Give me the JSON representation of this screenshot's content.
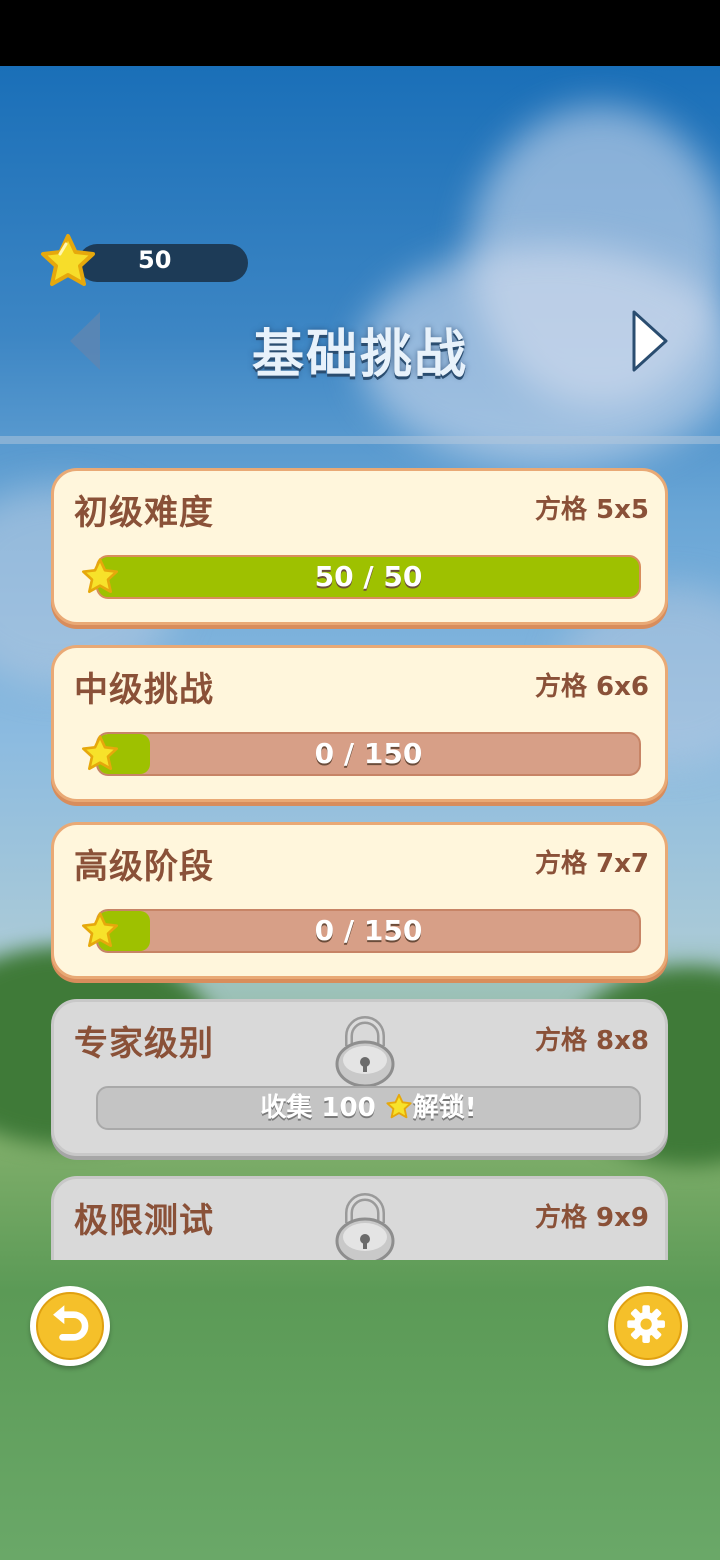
{
  "header": {
    "star_count": "50",
    "title": "基础挑战"
  },
  "levels": [
    {
      "title": "初级难度",
      "grid": "方格 5x5",
      "progress_text": "50 / 50",
      "progress": 1.0,
      "locked": false
    },
    {
      "title": "中级挑战",
      "grid": "方格 6x6",
      "progress_text": "0 / 150",
      "progress": 0.0,
      "locked": false
    },
    {
      "title": "高级阶段",
      "grid": "方格 7x7",
      "progress_text": "0 / 150",
      "progress": 0.0,
      "locked": false
    },
    {
      "title": "专家级别",
      "grid": "方格 8x8",
      "unlock_prefix": "收集 100 ",
      "unlock_suffix": "解锁!",
      "locked": true
    },
    {
      "title": "极限测试",
      "grid": "方格 9x9",
      "locked": true
    }
  ],
  "icons": {
    "star": "star-icon",
    "lock": "lock-icon",
    "back": "undo-arrow-icon",
    "settings": "gear-icon",
    "prev": "chevron-left-icon",
    "next": "chevron-right-icon"
  },
  "colors": {
    "accent_yellow": "#f5c02a",
    "progress_green": "#9ec100",
    "card_border": "#e9a975",
    "text_brown": "#8a5138"
  }
}
